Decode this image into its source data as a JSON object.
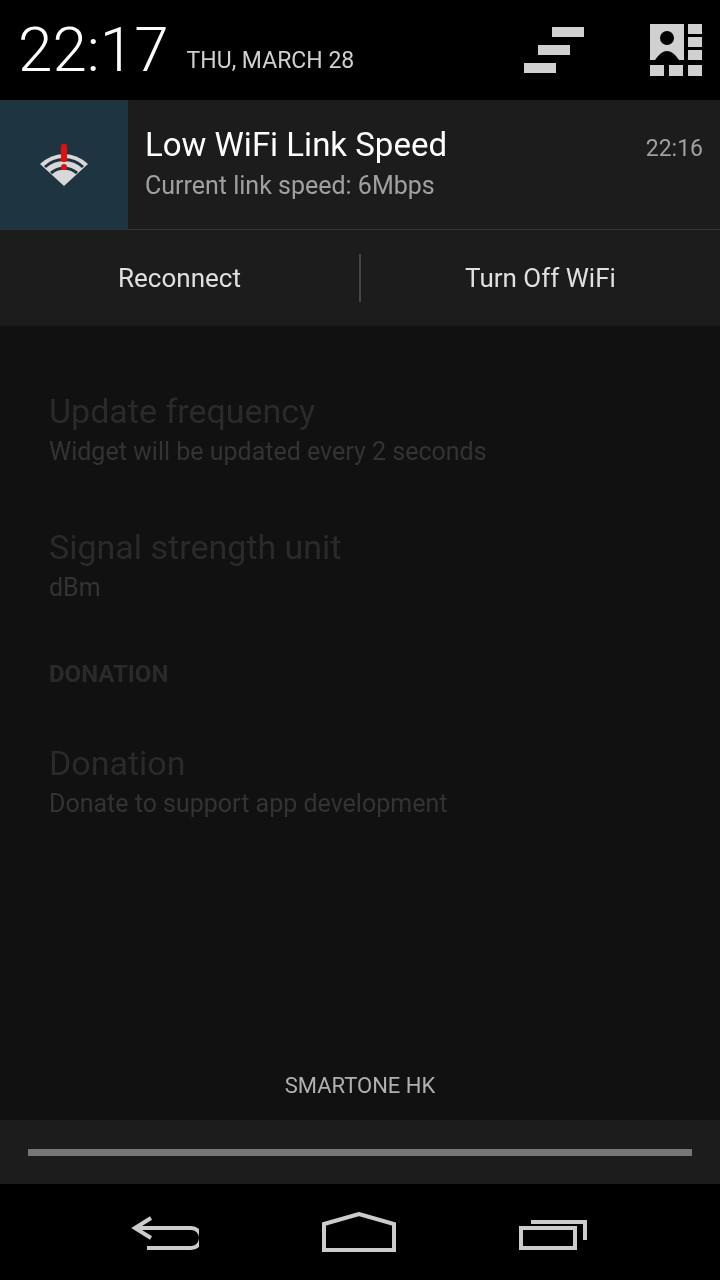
{
  "header": {
    "time": "22:17",
    "date": "THU, MARCH 28"
  },
  "notification": {
    "title": "Low WiFi Link Speed",
    "text": "Current link speed: 6Mbps",
    "time": "22:16",
    "actions": [
      {
        "label": "Reconnect"
      },
      {
        "label": "Turn Off WiFi"
      }
    ]
  },
  "background_settings": [
    {
      "kind": "item",
      "title": "Update frequency",
      "summary": "Widget will be updated every 2 seconds"
    },
    {
      "kind": "item",
      "title": "Signal strength unit",
      "summary": "dBm"
    },
    {
      "kind": "header",
      "title": "DONATION"
    },
    {
      "kind": "item",
      "title": "Donation",
      "summary": "Donate to support app development"
    }
  ],
  "carrier": "SMARTONE HK"
}
